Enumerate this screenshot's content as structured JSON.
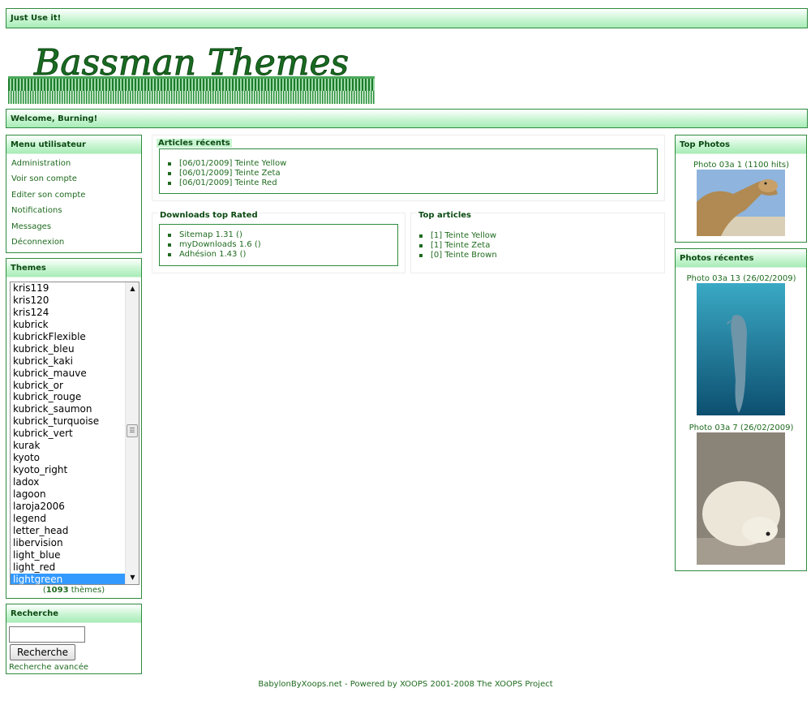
{
  "header": {
    "tagline": "Just Use it!",
    "logo_text": "Bassman Themes",
    "welcome": "Welcome, Burning!"
  },
  "user_menu": {
    "title": "Menu utilisateur",
    "items": [
      "Administration",
      "Voir son compte",
      "Editer son compte",
      "Notifications",
      "Messages",
      "Déconnexion"
    ]
  },
  "themes": {
    "title": "Themes",
    "items": [
      "kris119",
      "kris120",
      "kris124",
      "kubrick",
      "kubrickFlexible",
      "kubrick_bleu",
      "kubrick_kaki",
      "kubrick_mauve",
      "kubrick_or",
      "kubrick_rouge",
      "kubrick_saumon",
      "kubrick_turquoise",
      "kubrick_vert",
      "kurak",
      "kyoto",
      "kyoto_right",
      "ladox",
      "lagoon",
      "laroja2006",
      "legend",
      "letter_head",
      "libervision",
      "light_blue",
      "light_red",
      "lightgreen"
    ],
    "selected": "lightgreen",
    "count_open": "(",
    "count": "1093",
    "count_label": " thèmes)"
  },
  "search": {
    "title": "Recherche",
    "input_value": "",
    "button": "Recherche",
    "advanced": "Recherche avancée"
  },
  "recent_articles": {
    "title": "Articles récents",
    "items": [
      "[06/01/2009] Teinte Yellow",
      "[06/01/2009] Teinte Zeta",
      "[06/01/2009] Teinte Red"
    ]
  },
  "downloads": {
    "title": "Downloads top Rated",
    "items": [
      "Sitemap 1.31 ()",
      "myDownloads 1.6 ()",
      "Adhésion 1.43 ()"
    ]
  },
  "top_articles": {
    "title": "Top articles",
    "items": [
      "[1] Teinte Yellow",
      "[1] Teinte Zeta",
      "[0] Teinte Brown"
    ]
  },
  "top_photos": {
    "title": "Top Photos",
    "caption": "Photo 03a 1 (1100 hits)"
  },
  "recent_photos": {
    "title": "Photos récentes",
    "captions": [
      "Photo 03a 13 (26/02/2009)",
      "Photo 03a 7 (26/02/2009)"
    ]
  },
  "footer": "BabylonByXoops.net - Powered by XOOPS 2001-2008 The XOOPS Project",
  "colors": {
    "accent": "#2e8b3e",
    "text": "#1f6b1f",
    "bar_light": "#c9f5d2",
    "selection": "#3399ff"
  }
}
